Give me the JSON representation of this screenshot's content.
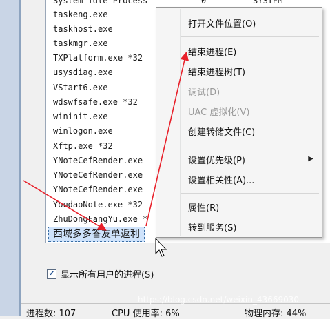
{
  "processes": [
    {
      "name": "System Idle Process",
      "c": "0",
      "d": "SYSTEM"
    },
    {
      "name": "taskeng.exe"
    },
    {
      "name": "taskhost.exe"
    },
    {
      "name": "taskmgr.exe"
    },
    {
      "name": "TXPlatform.exe *32"
    },
    {
      "name": "usysdiag.exe"
    },
    {
      "name": "VStart6.exe"
    },
    {
      "name": "wdswfsafe.exe *32"
    },
    {
      "name": "wininit.exe"
    },
    {
      "name": "winlogon.exe"
    },
    {
      "name": "Xftp.exe *32"
    },
    {
      "name": "YNoteCefRender.exe"
    },
    {
      "name": "YNoteCefRender.exe"
    },
    {
      "name": "YNoteCefRender.exe"
    },
    {
      "name": "YoudaoNote.exe *32"
    },
    {
      "name": "ZhuDongFangYu.exe *"
    }
  ],
  "selected_process": "西域多多答友单返利",
  "show_all_users": {
    "label": "显示所有用户的进程(S)",
    "checked": true
  },
  "status_bar": {
    "processes": "进程数: 107",
    "cpu": "CPU 使用率: 6%",
    "memory": "物理内存: 44%"
  },
  "context_menu": [
    {
      "label": "打开文件位置(O)",
      "enabled": true
    },
    {
      "label": "结束进程(E)",
      "enabled": true
    },
    {
      "label": "结束进程树(T)",
      "enabled": true
    },
    {
      "label": "调试(D)",
      "enabled": false
    },
    {
      "label": "UAC 虚拟化(V)",
      "enabled": false
    },
    {
      "label": "创建转储文件(C)",
      "enabled": true
    },
    {
      "label": "设置优先级(P)",
      "enabled": true,
      "submenu": true
    },
    {
      "label": "设置相关性(A)...",
      "enabled": true
    },
    {
      "label": "属性(R)",
      "enabled": true
    },
    {
      "label": "转到服务(S)",
      "enabled": true
    }
  ],
  "watermark": "https://blog.csdn.net/weixin_43669030",
  "colors": {
    "annotation_arrow": "#e8202a",
    "selection": "#cfe3fb"
  },
  "icons": {
    "submenu": "triangle-right-icon",
    "check": "checkmark-icon",
    "cursor": "mouse-pointer-icon"
  }
}
